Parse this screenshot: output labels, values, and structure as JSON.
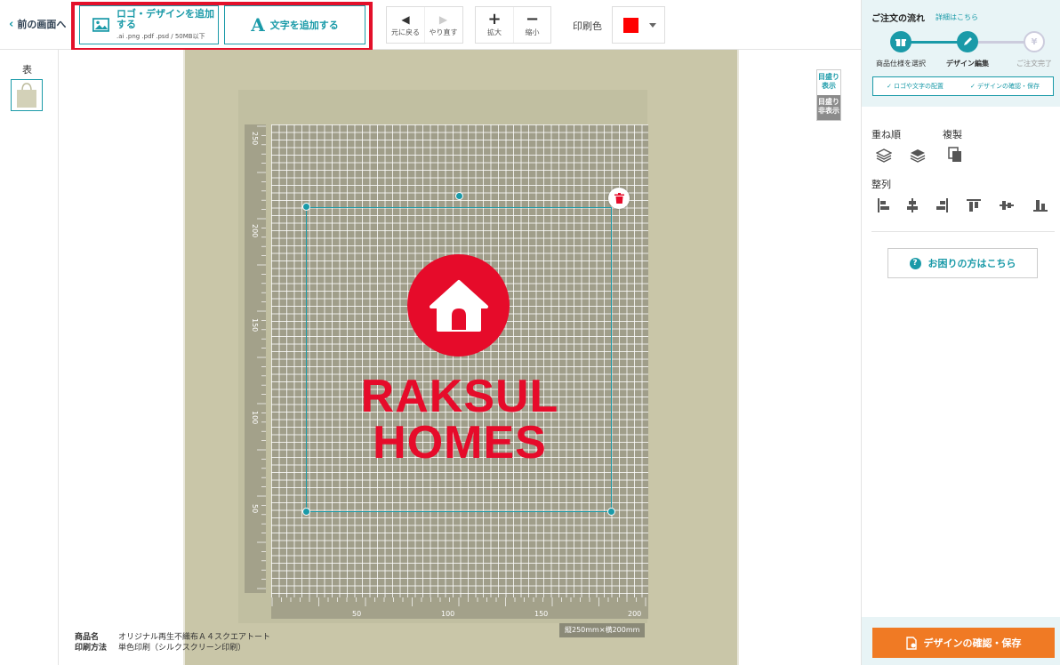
{
  "toolbar": {
    "back_label": "前の画面へ",
    "add_logo_label": "ロゴ・デザインを追加する",
    "add_logo_formats": ".ai .png .pdf .psd / 50MB以下",
    "add_text_label": "文字を追加する",
    "undo_label": "元に戻る",
    "redo_label": "やり直す",
    "zoom_in_label": "拡大",
    "zoom_out_label": "縮小",
    "print_color_label": "印刷色",
    "print_color_value": "#ff0000"
  },
  "sidebar": {
    "side_label": "表"
  },
  "canvas": {
    "ruler_v_ticks": [
      "250",
      "200",
      "150",
      "100",
      "50"
    ],
    "ruler_h_ticks": [
      "50",
      "100",
      "150",
      "200"
    ],
    "size_label": "縦250mm×横200mm",
    "brand_line1": "RAKSUL",
    "brand_line2": "HOMES",
    "grid_show_label": "目盛り表示",
    "grid_hide_label": "目盛り非表示"
  },
  "info": {
    "product_key": "商品名",
    "product_value": "オリジナル再生不織布Ａ４スクエアトート",
    "method_key": "印刷方法",
    "method_value": "単色印刷（シルクスクリーン印刷）"
  },
  "right": {
    "flow_title": "ご注文の流れ",
    "flow_link": "詳細はこちら",
    "steps": [
      {
        "label": "商品仕様を選択"
      },
      {
        "label": "デザイン編集"
      },
      {
        "label": "ご注文完了"
      }
    ],
    "sub_steps": [
      "ロゴや文字の配置",
      "デザインの確認・保存"
    ],
    "layer_label": "重ね順",
    "duplicate_label": "複製",
    "align_label": "整列",
    "help_label": "お困りの方はこちら",
    "confirm_label": "デザインの確認・保存"
  },
  "colors": {
    "accent": "#1a9aa8",
    "brand_red": "#e60b2a",
    "confirm_orange": "#f07a24"
  }
}
